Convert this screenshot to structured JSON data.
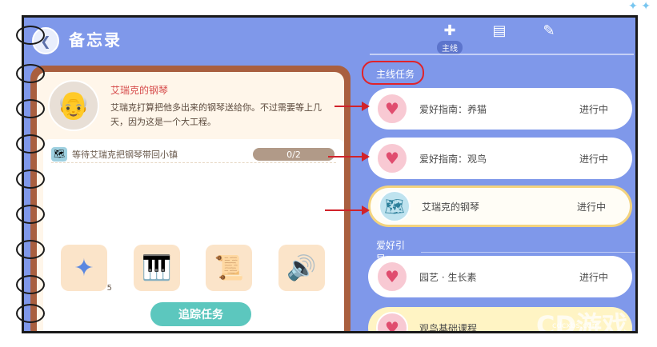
{
  "header": {
    "back_icon": "back-arrow-icon",
    "title": "备忘录",
    "tabs": [
      {
        "icon": "quest-icon",
        "label": "主线",
        "active": true
      },
      {
        "icon": "notes-icon",
        "label": "",
        "active": false
      },
      {
        "icon": "hint-icon",
        "label": "",
        "active": false
      }
    ]
  },
  "detail": {
    "npc_name": "艾瑞克的钢琴",
    "description": "艾瑞克打算把他多出来的钢琴送给你。不过需要等上几天，因为这是一个大工程。",
    "task": {
      "text": "等待艾瑞克把钢琴带回小镇",
      "progress": "0/2"
    },
    "rewards": [
      {
        "icon": "badge-icon",
        "qty": "5"
      },
      {
        "icon": "piano-icon",
        "qty": ""
      },
      {
        "icon": "sheet-music-icon",
        "qty": ""
      },
      {
        "icon": "speaker-icon",
        "qty": ""
      }
    ],
    "track_button": "追踪任务"
  },
  "sections": {
    "main": "主线任务",
    "hobby": "爱好引导"
  },
  "quests_main": [
    {
      "title": "爱好指南：养猫",
      "status": "进行中",
      "icon": "heart-icon"
    },
    {
      "title": "爱好指南：观鸟",
      "status": "进行中",
      "icon": "heart-icon"
    },
    {
      "title": "艾瑞克的钢琴",
      "status": "进行中",
      "icon": "map-icon"
    }
  ],
  "quests_hobby": [
    {
      "title": "园艺 · 生长素",
      "status": "进行中",
      "icon": "heart-icon"
    },
    {
      "title": "观鸟基础课程",
      "status": "",
      "icon": "heart-icon"
    }
  ],
  "watermark": {
    "text": "CD游戏",
    "small": "cdcxbs.com"
  },
  "colors": {
    "background": "#7f98ea",
    "accent_red": "#d1222a",
    "track_button": "#5cc7be",
    "active_border": "#f3d37e"
  }
}
